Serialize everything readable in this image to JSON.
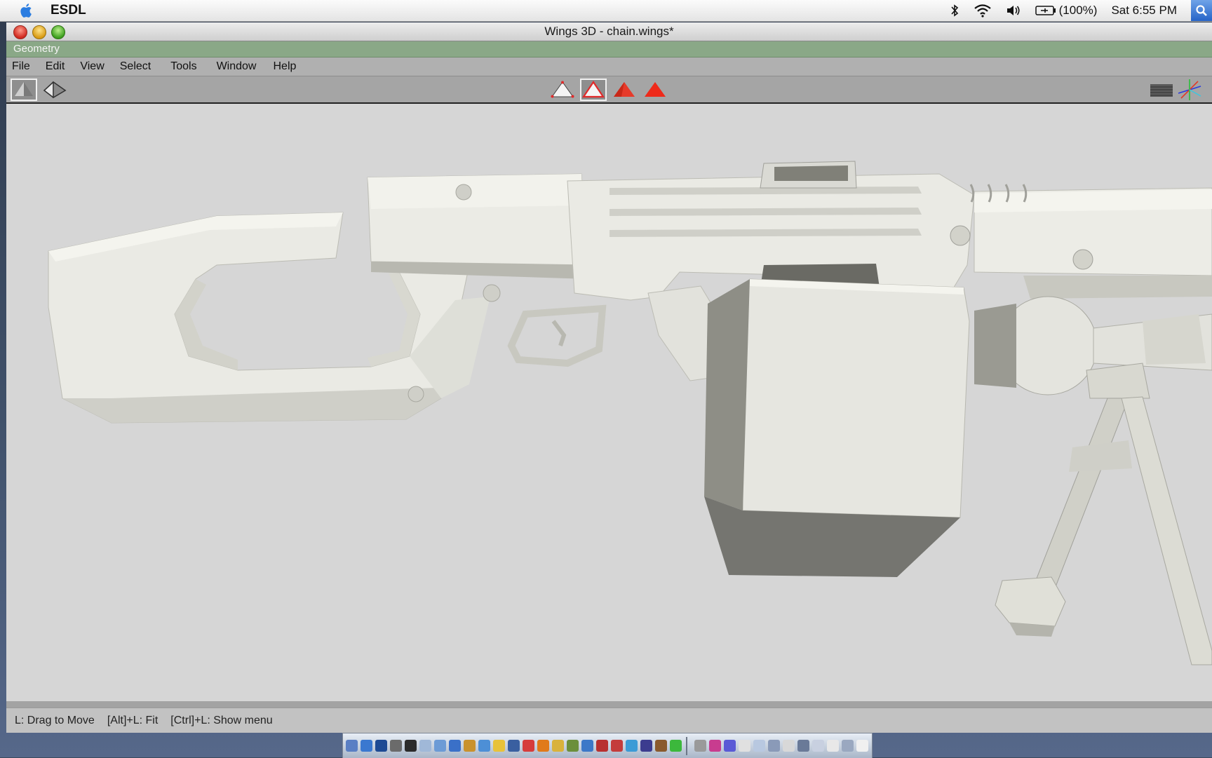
{
  "menubar": {
    "app_name": "ESDL",
    "battery": "(100%)",
    "clock": "Sat 6:55 PM",
    "icons": [
      "apple-icon",
      "bluetooth-icon",
      "wifi-icon",
      "volume-icon",
      "battery-icon",
      "spotlight-icon"
    ]
  },
  "window": {
    "title": "Wings 3D - chain.wings*",
    "panel_label": "Geometry"
  },
  "menu": {
    "items": [
      "File",
      "Edit",
      "View",
      "Select",
      "Tools",
      "Window",
      "Help"
    ]
  },
  "toolbar": {
    "left_icons": [
      "smooth-shading-icon",
      "wireframe-icon"
    ],
    "mode_icons": [
      "vertex-mode-icon",
      "edge-mode-icon",
      "face-mode-icon",
      "body-mode-icon"
    ],
    "right_icons": [
      "groundplane-icon",
      "axes-icon"
    ],
    "active_mode": "edge"
  },
  "status": {
    "hint_drag": "L: Drag to Move",
    "hint_fit": "[Alt]+L: Fit",
    "hint_menu": "[Ctrl]+L: Show menu"
  },
  "dock": {
    "colors": [
      "#5a7fc4",
      "#3a78d0",
      "#1d4a94",
      "#6b6b6b",
      "#2b2b2b",
      "#a0b8d8",
      "#6c9bd6",
      "#3a70c8",
      "#c9922e",
      "#4d8fd6",
      "#e8c23a",
      "#3a5fa0",
      "#d63c3c",
      "#e07a1a",
      "#d9b23c",
      "#6b8f3c",
      "#3c78c8",
      "#b83030",
      "#c43c3c",
      "#3c9bd6",
      "#3c3c8f",
      "#8a5a2e",
      "#3cb83c",
      "#9a9a9a",
      "#c83c8f",
      "#5a5ad6",
      "#e0e0e0",
      "#b8c8e0",
      "#8a9ab8",
      "#d8d8d8",
      "#6a7a98",
      "#c8d0e0",
      "#e8e8e8",
      "#9aa8c0",
      "#f0f0f0"
    ]
  }
}
